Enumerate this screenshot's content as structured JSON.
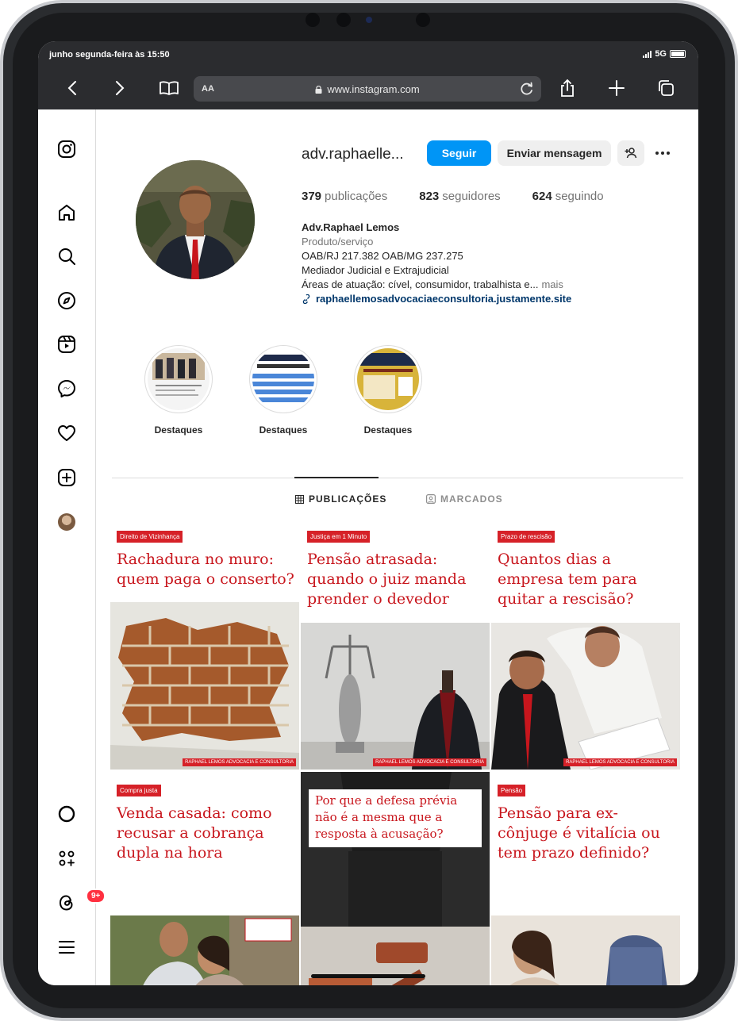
{
  "status_bar": {
    "time": "junho segunda-feira às 15:50",
    "network": "5G"
  },
  "browser": {
    "text_size_label": "AA",
    "url": "www.instagram.com"
  },
  "sidebar": {
    "notifications_badge": "9+"
  },
  "profile": {
    "username": "adv.raphaelle...",
    "follow_label": "Seguir",
    "message_label": "Enviar mensagem",
    "stats": {
      "posts_count": "379",
      "posts_label": "publicações",
      "followers_count": "823",
      "followers_label": "seguidores",
      "following_count": "624",
      "following_label": "seguindo"
    },
    "bio": {
      "name": "Adv.Raphael Lemos",
      "category": "Produto/serviço",
      "line1": "OAB/RJ 217.382 OAB/MG 237.275",
      "line2": "Mediador Judicial e Extrajudicial",
      "line3": "Áreas de atuação: cível, consumidor, trabalhista e...",
      "more": "mais",
      "link": "raphaellemosadvocaciaeconsultoria.justamente.site"
    }
  },
  "highlights": [
    {
      "label": "Destaques"
    },
    {
      "label": "Destaques"
    },
    {
      "label": "Destaques"
    }
  ],
  "tabs": {
    "posts": "PUBLICAÇÕES",
    "tagged": "MARCADOS"
  },
  "posts": [
    {
      "tag": "Direito de Vizinhança",
      "title": "Rachadura no muro: quem paga o conserto?",
      "footer": "RAPHAEL LEMOS ADVOCACIA E CONSULTORIA"
    },
    {
      "tag": "Justiça em 1 Minuto",
      "title": "Pensão atrasada: quando o juiz manda prender o devedor",
      "footer": "RAPHAEL LEMOS ADVOCACIA E CONSULTORIA"
    },
    {
      "tag": "Prazo de rescisão",
      "title": "Quantos dias a empresa tem para quitar a rescisão?",
      "footer": "RAPHAEL LEMOS ADVOCACIA E CONSULTORIA"
    },
    {
      "tag": "Compra justa",
      "title": "Venda casada: como recusar a cobrança dupla na hora",
      "footer": ""
    },
    {
      "tag": "",
      "title": "Por que a defesa prévia não é a mesma que a resposta à acusação?",
      "footer": ""
    },
    {
      "tag": "Pensão",
      "title": "Pensão para ex-cônjuge é vitalícia ou tem prazo definido?",
      "footer": ""
    }
  ],
  "colors": {
    "follow_button": "#0095f6",
    "post_accent": "#c8161d",
    "browser_bar": "#2b2c2f"
  }
}
